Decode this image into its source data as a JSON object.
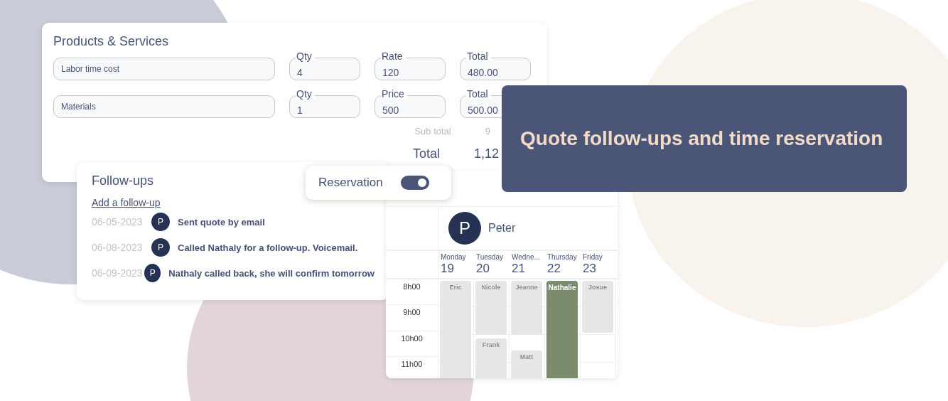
{
  "products": {
    "title": "Products & Services",
    "rows": [
      {
        "description": "Labor time cost",
        "fields": [
          {
            "label": "Qty",
            "value": "4"
          },
          {
            "label": "Rate",
            "value": "120"
          },
          {
            "label": "Total",
            "value": "480.00"
          }
        ]
      },
      {
        "description": "Materials",
        "fields": [
          {
            "label": "Qty",
            "value": "1"
          },
          {
            "label": "Price",
            "value": "500"
          },
          {
            "label": "Total",
            "value": "500.00"
          }
        ]
      }
    ],
    "subtotal_label": "Sub total",
    "subtotal_value": "9",
    "total_label": "Total",
    "total_value": "1,12"
  },
  "follow_ups": {
    "title": "Follow-ups",
    "add_link": "Add a follow-up",
    "items": [
      {
        "date": "06-05-2023",
        "avatar": "P",
        "text": "Sent quote by email"
      },
      {
        "date": "06-08-2023",
        "avatar": "P",
        "text": "Called Nathaly for a follow-up. Voicemail."
      },
      {
        "date": "06-09-2023",
        "avatar": "P",
        "text": "Nathaly called back, she will confirm tomorrow"
      }
    ]
  },
  "reservation": {
    "label": "Reservation",
    "on": true
  },
  "calendar": {
    "person": {
      "avatar": "P",
      "name": "Peter"
    },
    "hours": [
      "8h00",
      "9h00",
      "10h00",
      "11h00"
    ],
    "days": [
      {
        "name": "Monday",
        "date": "19",
        "events": [
          {
            "name": "Eric",
            "color": "#e6e6e6"
          }
        ]
      },
      {
        "name": "Tuesday",
        "date": "20",
        "events": [
          {
            "name": "Nicole",
            "color": "#e6e6e6"
          },
          {
            "name": "Frank",
            "color": "#e6e6e6"
          }
        ]
      },
      {
        "name": "Wedne...",
        "date": "21",
        "events": [
          {
            "name": "Jeanne",
            "color": "#e6e6e6"
          },
          {
            "name": "Matt",
            "color": "#e6e6e6"
          }
        ]
      },
      {
        "name": "Thursday",
        "date": "22",
        "events": [
          {
            "name": "Nathalie",
            "color": "#7b8c6c"
          }
        ]
      },
      {
        "name": "Friday",
        "date": "23",
        "events": [
          {
            "name": "Josue",
            "color": "#e6e6e6"
          }
        ]
      }
    ]
  },
  "banner": {
    "text": "Quote follow-ups and time reservation"
  }
}
